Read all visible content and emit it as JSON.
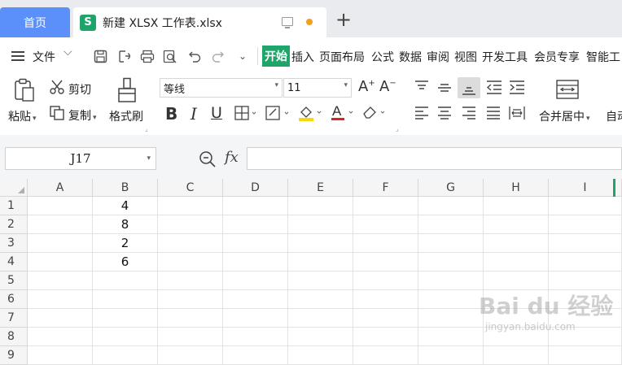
{
  "tabs": {
    "home_label": "首页",
    "doc_icon_letter": "S",
    "doc_title": "新建 XLSX 工作表.xlsx",
    "add_label": "+"
  },
  "menu": {
    "file_label": "文件",
    "items": [
      "开始",
      "插入",
      "页面布局",
      "公式",
      "数据",
      "审阅",
      "视图",
      "开发工具",
      "会员专享",
      "智能工"
    ],
    "active_index": 0
  },
  "ribbon": {
    "paste_label": "粘贴",
    "cut_label": "剪切",
    "copy_label": "复制",
    "format_painter_label": "格式刷",
    "font_name": "等线",
    "font_size": "11",
    "merge_center_label": "合并居中",
    "auto_label": "自动"
  },
  "formula_bar": {
    "cell_ref": "J17",
    "fx_label": "fx",
    "formula": ""
  },
  "sheet": {
    "columns": [
      "A",
      "B",
      "C",
      "D",
      "E",
      "F",
      "G",
      "H",
      "I"
    ],
    "rows": [
      "1",
      "2",
      "3",
      "4",
      "5",
      "6",
      "7",
      "8",
      "9"
    ],
    "cells": {
      "B1": "4",
      "B2": "8",
      "B3": "2",
      "B4": "6"
    }
  },
  "watermark": {
    "text": "Bai du 经验",
    "sub": "jingyan.baidu.com"
  },
  "colors": {
    "tab_active": "#5b8ff9",
    "accent_green": "#1fa56a"
  }
}
